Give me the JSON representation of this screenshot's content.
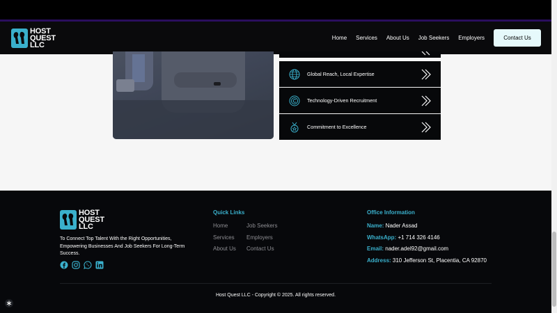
{
  "header": {
    "logo": {
      "line1": "HOST",
      "line2": "QUEST",
      "line3": "LLC"
    },
    "nav": [
      {
        "label": "Home"
      },
      {
        "label": "Services"
      },
      {
        "label": "About Us"
      },
      {
        "label": "Job Seekers"
      },
      {
        "label": "Employers"
      }
    ],
    "cta": "Contact Us"
  },
  "features": [
    {
      "label": "Global Reach, Local Expertise",
      "icon": "globe-icon"
    },
    {
      "label": "Technology-Driven Recruitment",
      "icon": "chip-icon"
    },
    {
      "label": "Commitment to Excellence",
      "icon": "medal-icon"
    }
  ],
  "footer": {
    "logo": {
      "line1": "HOST",
      "line2": "QUEST",
      "line3": "LLC"
    },
    "tagline": "To Connect Top Talent With the Right Opportunities, Empowering Businesses And Job Seekers For Long-Term Success.",
    "socials": [
      "facebook-icon",
      "instagram-icon",
      "whatsapp-icon",
      "linkedin-icon"
    ],
    "quick_links_title": "Quick Links",
    "quick_links": [
      "Home",
      "Job Seekers",
      "Services",
      "Employers",
      "About Us",
      "Contact Us"
    ],
    "office_title": "Office Information",
    "office": [
      {
        "key": "Name:",
        "value": " Nader Assad"
      },
      {
        "key": "WhatsApp:",
        "value": " +1 714 326 4146"
      },
      {
        "key": "Email:",
        "value": " nader.adel92@gmail.com"
      },
      {
        "key": "Address:",
        "value": " 310 Jefferson St, Placentia, CA 92870"
      }
    ],
    "copyright": "Host Quest LLC - Copyright © 2025. All rights reserved."
  },
  "colors": {
    "accent": "#3ab0cc",
    "cta_bg": "#e6f9fb",
    "footer_bg": "#07080b",
    "section_bg": "#f6f6f6"
  }
}
